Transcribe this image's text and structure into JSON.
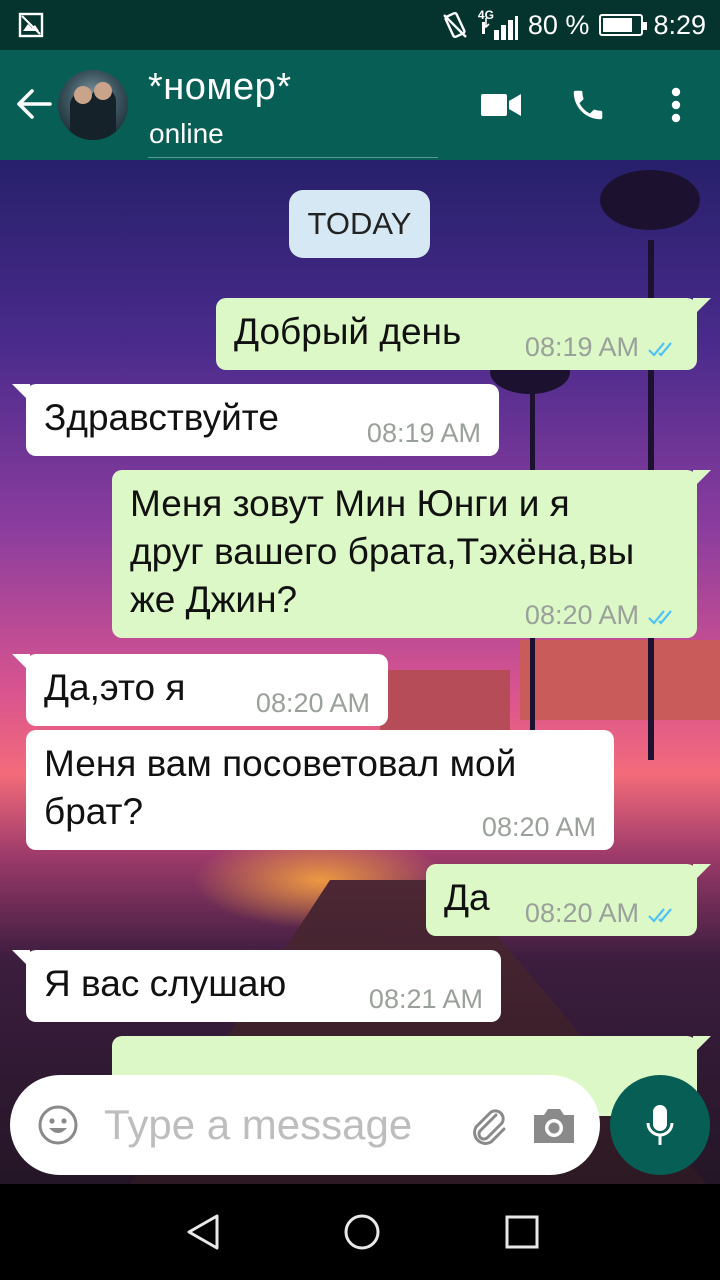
{
  "status_bar": {
    "network": "4G",
    "battery": "80 %",
    "battery_level": 0.8,
    "time": "8:29"
  },
  "header": {
    "contact_name": "*номер*",
    "status": "online"
  },
  "chat": {
    "date_chip": "TODAY",
    "messages": [
      {
        "dir": "out",
        "text": "Добрый день",
        "time": "08:19 AM",
        "read": true
      },
      {
        "dir": "in",
        "text": "Здравствуйте",
        "time": "08:19 AM"
      },
      {
        "dir": "out",
        "text": "Меня зовут Мин Юнги и я друг вашего брата,Тэхёна,вы же Джин?",
        "time": "08:20 AM",
        "read": true
      },
      {
        "dir": "in",
        "text": "Да,это я",
        "time": "08:20 AM"
      },
      {
        "dir": "in",
        "text": "Меня вам посоветовал мой брат?",
        "time": "08:20 AM"
      },
      {
        "dir": "out",
        "text": "Да",
        "time": "08:20 AM",
        "read": true
      },
      {
        "dir": "in",
        "text": "Я вас слушаю",
        "time": "08:21 AM"
      }
    ]
  },
  "composer": {
    "placeholder": "Type a message"
  },
  "icons": {
    "back": "arrow-left-icon",
    "video": "video-call-icon",
    "call": "phone-icon",
    "menu": "more-vert-icon",
    "emoji": "emoji-icon",
    "attach": "paperclip-icon",
    "camera": "camera-icon",
    "mic": "microphone-icon",
    "read_receipt": "double-check-icon"
  },
  "colors": {
    "header": "#075e54",
    "status_bar": "#05342f",
    "outgoing_bubble": "#dcf8c6",
    "incoming_bubble": "#ffffff",
    "read_ticks": "#4fc3f7"
  }
}
